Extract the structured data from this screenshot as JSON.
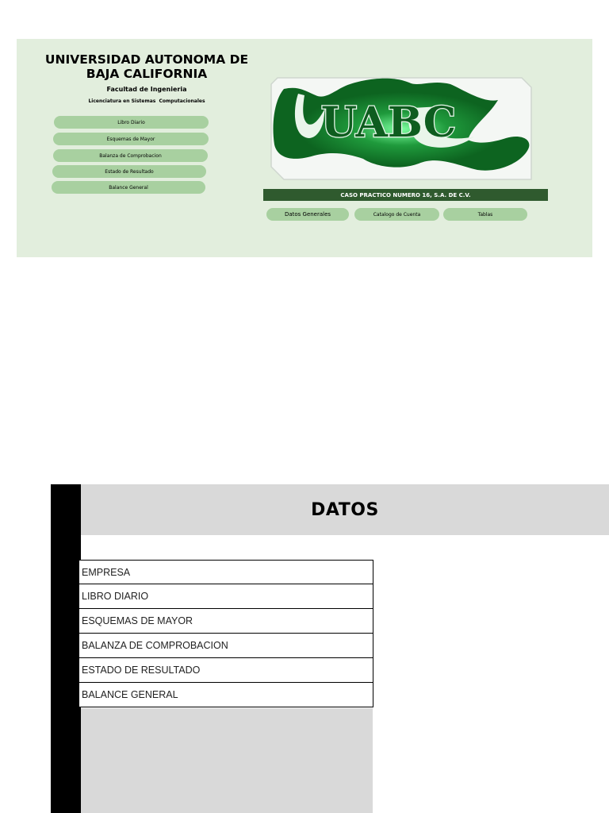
{
  "header": {
    "university": "UNIVERSIDAD AUTONOMA DE BAJA CALIFORNIA",
    "faculty": "Facultad de Ingenieria",
    "degree": "Licenciatura en Sistemas  Computacionales"
  },
  "menu": [
    "Libro Diario",
    "Esquemas de Mayor",
    "Balanza de Comprobacion",
    "Estado de Resultado",
    "Balance General"
  ],
  "logo": {
    "text": "UABC",
    "color": "#1a7a2a"
  },
  "case_title": "CASO PRACTICO NUMERO 16, S.A. DE C.V.",
  "tabs": [
    "Datos Generales",
    "Catalogo de Cuenta",
    "Tablas"
  ],
  "datos": {
    "title": "DATOS",
    "rows": [
      "EMPRESA",
      "LIBRO DIARIO",
      "ESQUEMAS DE MAYOR",
      "BALANZA DE COMPROBACION",
      "ESTADO DE RESULTADO",
      "BALANCE GENERAL"
    ]
  },
  "colors": {
    "panel_bg": "#e2eedd",
    "pill_bg": "#a8d0a0",
    "case_bar": "#2f5a2e",
    "grey": "#d9d9d9"
  }
}
